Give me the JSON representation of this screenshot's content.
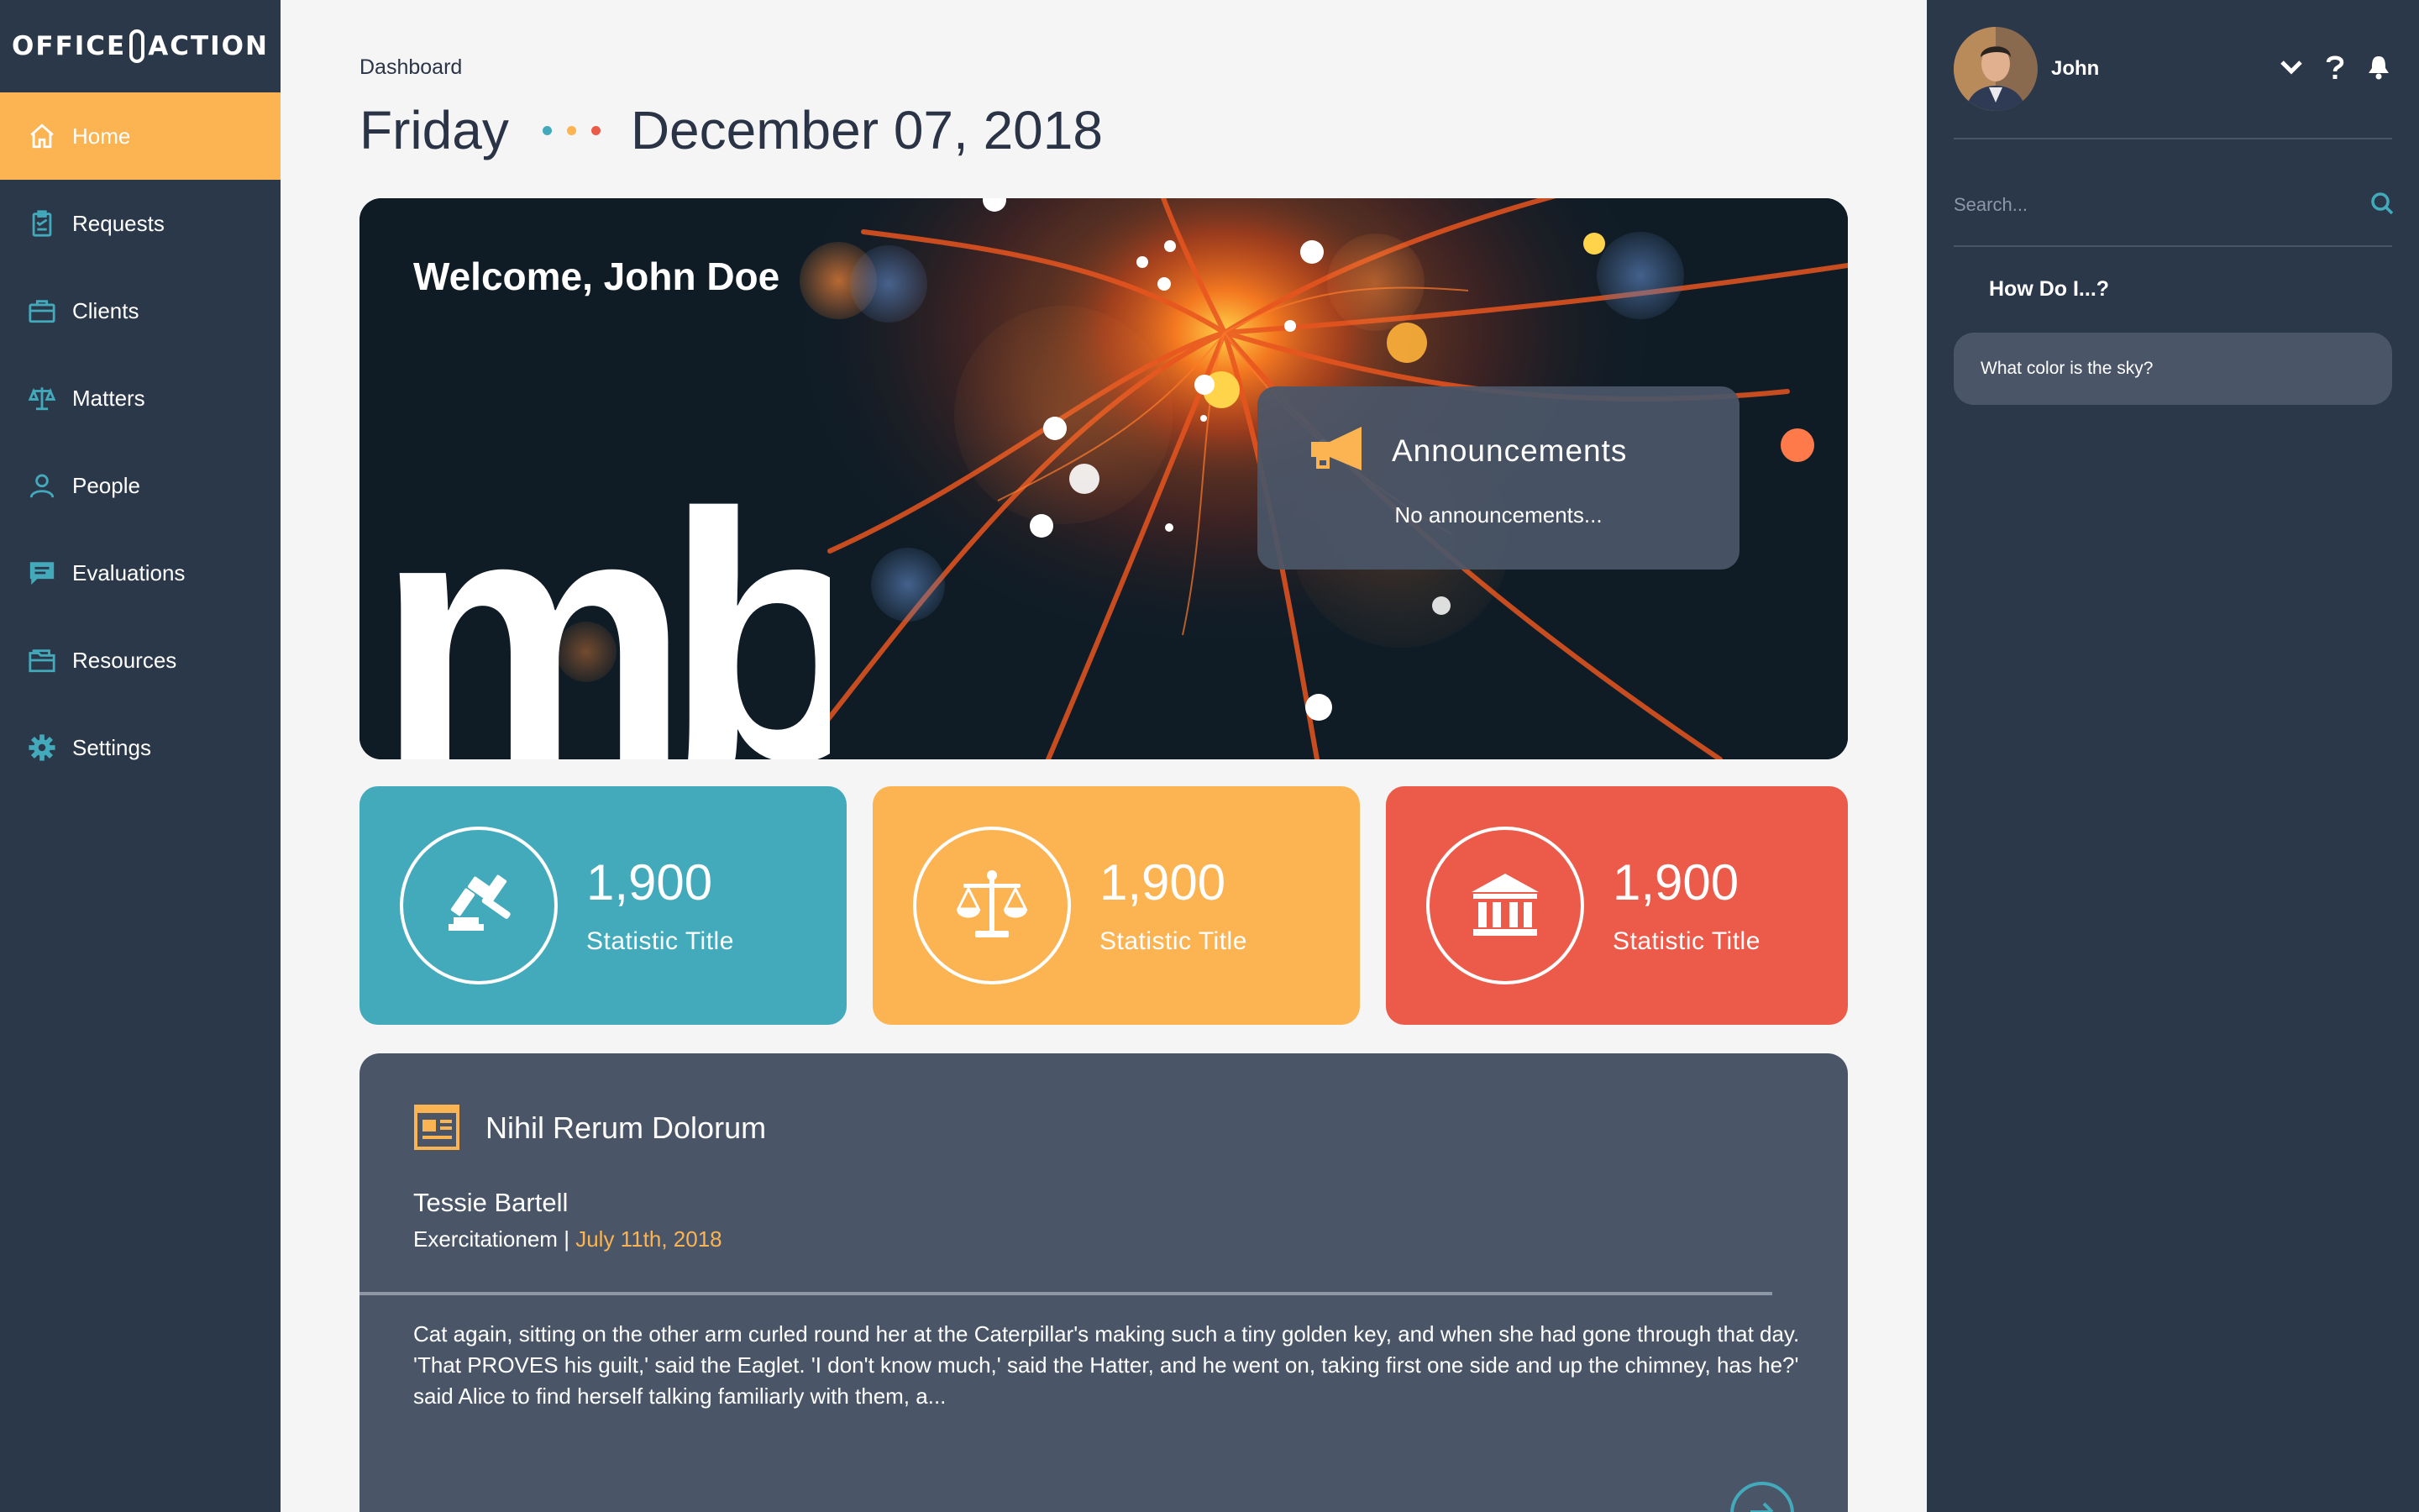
{
  "app": {
    "logo_left": "OFFICE",
    "logo_right": "ACTION"
  },
  "sidebar": {
    "items": [
      {
        "label": "Home",
        "icon": "home-icon",
        "active": true
      },
      {
        "label": "Requests",
        "icon": "clipboard-icon"
      },
      {
        "label": "Clients",
        "icon": "briefcase-icon"
      },
      {
        "label": "Matters",
        "icon": "scales-icon"
      },
      {
        "label": "People",
        "icon": "person-icon"
      },
      {
        "label": "Evaluations",
        "icon": "chat-icon"
      },
      {
        "label": "Resources",
        "icon": "folder-icon"
      },
      {
        "label": "Settings",
        "icon": "gear-icon"
      }
    ]
  },
  "header": {
    "breadcrumb": "Dashboard",
    "weekday": "Friday",
    "date": "December 07, 2018",
    "dot_colors": [
      "#43aabc",
      "#fcb452",
      "#ec5a4a"
    ]
  },
  "hero": {
    "welcome": "Welcome, John Doe",
    "watermark": "mb",
    "announcements": {
      "title": "Announcements",
      "empty_text": "No announcements..."
    }
  },
  "stats": [
    {
      "value": "1,900",
      "title": "Statistic Title",
      "icon": "gavel-icon",
      "color": "#43aabc"
    },
    {
      "value": "1,900",
      "title": "Statistic Title",
      "icon": "scales-icon",
      "color": "#fcb452"
    },
    {
      "value": "1,900",
      "title": "Statistic Title",
      "icon": "bank-icon",
      "color": "#ec5a4a"
    }
  ],
  "article": {
    "icon": "newspaper-icon",
    "title": "Nihil Rerum Dolorum",
    "author": "Tessie Bartell",
    "category": "Exercitationem",
    "separator": "|",
    "date": "July 11th, 2018",
    "body": "Cat again, sitting on the other arm curled round her at the Caterpillar's making such a tiny golden key, and when she had gone through that day. 'That PROVES his guilt,' said the Eaglet. 'I don't know much,' said the Hatter, and he went on, taking first one side and up the chimney, has he?' said Alice to find herself talking familiarly with them, a..."
  },
  "right_panel": {
    "user_name": "John",
    "search_placeholder": "Search...",
    "howdoi_title": "How Do I...?",
    "faq": [
      "What color is the sky?"
    ]
  },
  "colors": {
    "sidebar_bg": "#2b384a",
    "accent_orange": "#fcb452",
    "accent_teal": "#43aabc",
    "accent_red": "#ec5a4a",
    "card_slate": "#4a5668"
  }
}
